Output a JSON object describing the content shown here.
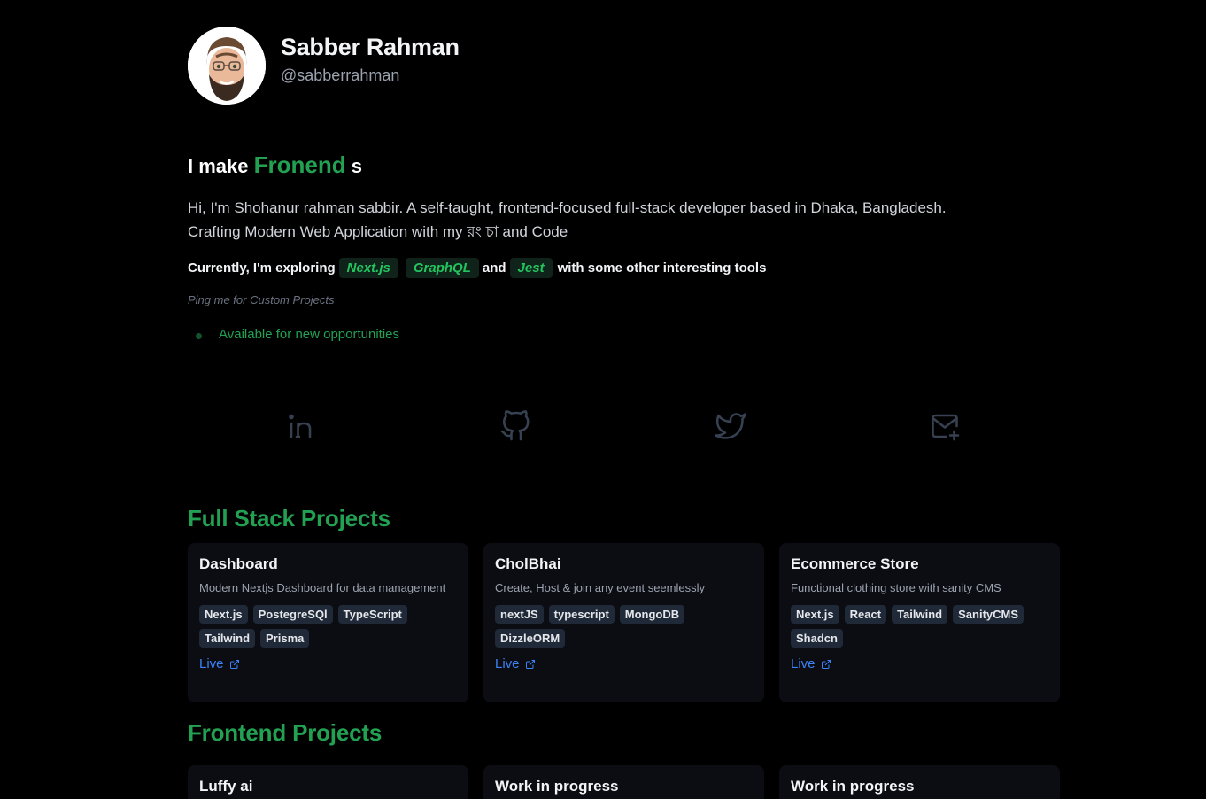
{
  "profile": {
    "name": "Sabber Rahman",
    "handle": "@sabberrahman"
  },
  "headline": {
    "prefix": "I make ",
    "accent": "Fronend",
    "suffix": " s"
  },
  "bio": {
    "line1": "Hi, I'm Shohanur rahman sabbir. A self-taught, frontend-focused full-stack developer based in Dhaka, Bangladesh.",
    "line2": "Crafting Modern Web Application with my রং চা and Code"
  },
  "exploring": {
    "prefix": "Currently, I'm exploring",
    "chip1": "Next.js",
    "chip2": "GraphQL",
    "and": "and",
    "chip3": "Jest",
    "suffix": "with some other interesting tools"
  },
  "ping": "Ping me for Custom Projects",
  "availability": "Available for new opportunities",
  "socials": [
    {
      "icon": "linkedin-icon"
    },
    {
      "icon": "github-icon"
    },
    {
      "icon": "twitter-icon"
    },
    {
      "icon": "mail-plus-icon"
    }
  ],
  "fullstack": {
    "title": "Full Stack Projects",
    "projects": [
      {
        "title": "Dashboard",
        "desc": "Modern Nextjs Dashboard for data management",
        "tags": [
          "Next.js",
          "PostegreSQl",
          "TypeScript",
          "Tailwind",
          "Prisma"
        ],
        "live": "Live"
      },
      {
        "title": "CholBhai",
        "desc": "Create, Host & join any event seemlessly",
        "tags": [
          "nextJS",
          "typescript",
          "MongoDB",
          "DizzleORM"
        ],
        "live": "Live"
      },
      {
        "title": "Ecommerce Store",
        "desc": "Functional clothing store with sanity CMS",
        "tags": [
          "Next.js",
          "React",
          "Tailwind",
          "SanityCMS",
          "Shadcn"
        ],
        "live": "Live"
      }
    ]
  },
  "frontend": {
    "title": "Frontend Projects",
    "projects": [
      {
        "title": "Luffy ai"
      },
      {
        "title": "Work in progress"
      },
      {
        "title": "Work in progress"
      }
    ]
  },
  "colors": {
    "accent": "#22a152",
    "link": "#3b82f6",
    "card_bg": "#0b0d12",
    "tag_bg": "#1f2937"
  }
}
